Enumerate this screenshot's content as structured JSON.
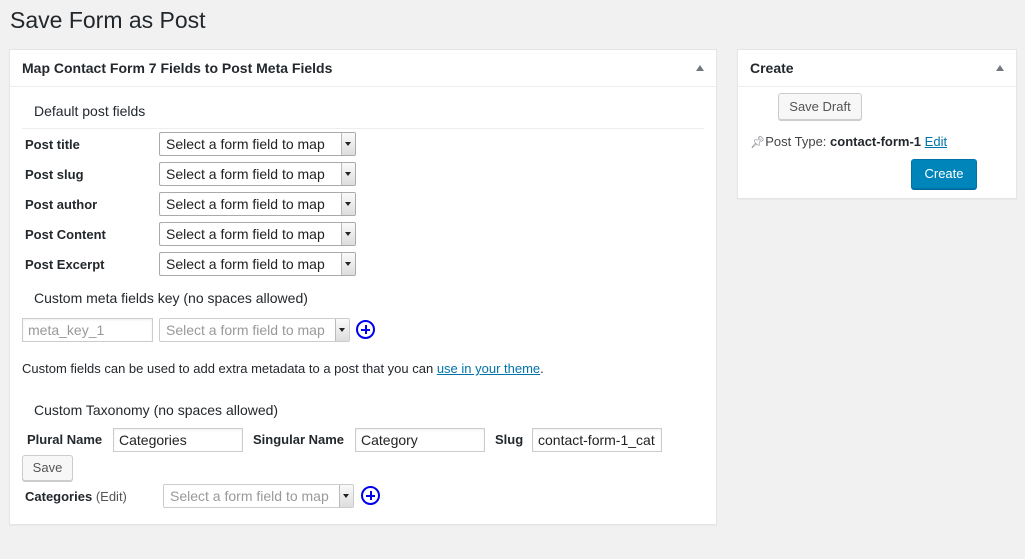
{
  "page": {
    "title": "Save Form as Post"
  },
  "main_box": {
    "title": "Map Contact Form 7 Fields to Post Meta Fields",
    "default_section": "Default post fields",
    "rows": [
      {
        "label": "Post title",
        "select": "Select a form field to map"
      },
      {
        "label": "Post slug",
        "select": "Select a form field to map"
      },
      {
        "label": "Post author",
        "select": "Select a form field to map"
      },
      {
        "label": "Post Content",
        "select": "Select a form field to map"
      },
      {
        "label": "Post Excerpt",
        "select": "Select a form field to map"
      }
    ],
    "custom_meta": {
      "heading": "Custom meta fields key (no spaces allowed)",
      "key_placeholder": "meta_key_1",
      "select": "Select a form field to map",
      "help_text": "Custom fields can be used to add extra metadata to a post that you can ",
      "help_link": "use in your theme",
      "help_end": "."
    },
    "taxonomy": {
      "heading": "Custom Taxonomy (no spaces allowed)",
      "plural_label": "Plural Name",
      "plural_value": "Categories",
      "singular_label": "Singular Name",
      "singular_value": "Category",
      "slug_label": "Slug",
      "slug_value": "contact-form-1_cat",
      "save_label": "Save",
      "categories_label": "Categories",
      "edit_label": "(Edit)",
      "select": "Select a form field to map"
    }
  },
  "side_box": {
    "title": "Create",
    "save_draft": "Save Draft",
    "post_type_label": "Post Type: ",
    "post_type_value": "contact-form-1",
    "edit_link": "Edit",
    "create_label": "Create"
  }
}
